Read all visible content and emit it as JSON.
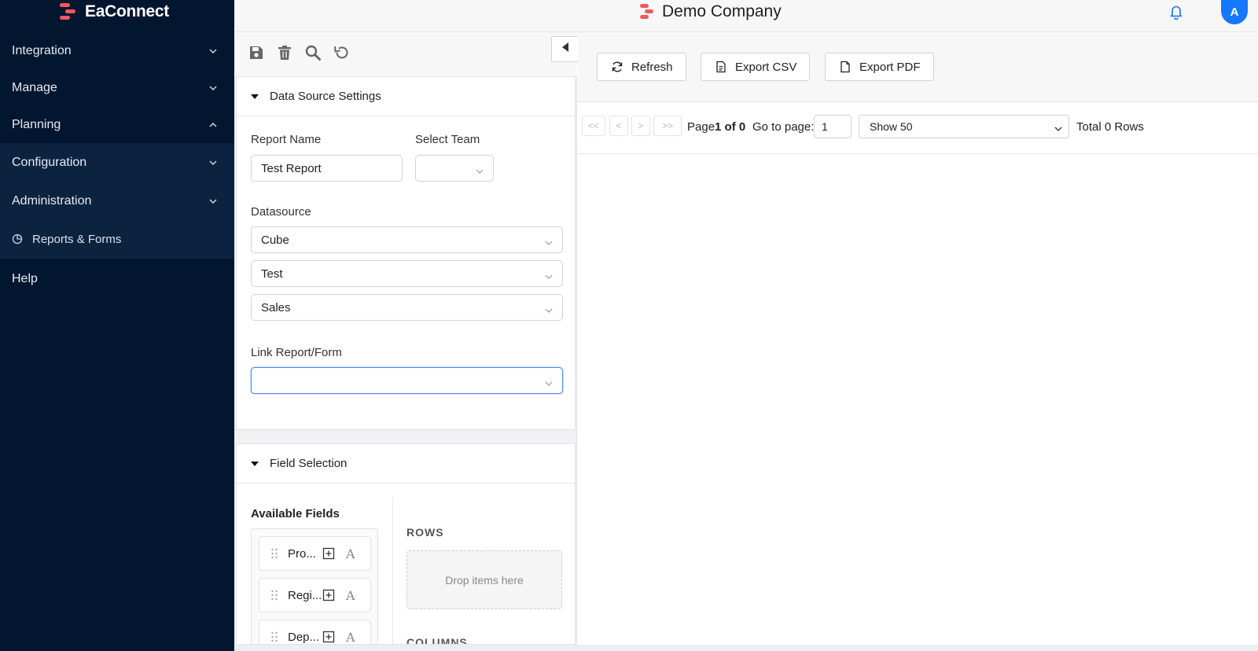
{
  "app": {
    "name": "EaConnect"
  },
  "header": {
    "company": "Demo Company",
    "avatar_initial": "A"
  },
  "sidebar": {
    "items": [
      {
        "label": "Integration",
        "chevron": "down"
      },
      {
        "label": "Manage",
        "chevron": "down"
      },
      {
        "label": "Planning",
        "chevron": "up"
      },
      {
        "label": "Configuration",
        "chevron": "down"
      },
      {
        "label": "Administration",
        "chevron": "down"
      },
      {
        "label": "Reports & Forms",
        "icon": "pie-chart-icon"
      },
      {
        "label": "Help"
      }
    ]
  },
  "toolbar": {
    "icons": [
      "save-icon",
      "delete-icon",
      "search-icon",
      "undo-icon",
      "collapse-left-icon"
    ]
  },
  "data_source": {
    "section_title": "Data Source Settings",
    "report_name_label": "Report Name",
    "report_name_value": "Test Report",
    "team_label": "Select Team",
    "team_value": "",
    "datasource_label": "Datasource",
    "datasource_values": [
      "Cube",
      "Test",
      "Sales"
    ],
    "link_label": "Link Report/Form",
    "link_value": ""
  },
  "field_selection": {
    "section_title": "Field Selection",
    "available_title": "Available Fields",
    "fields": [
      "Pro...",
      "Regi...",
      "Dep..."
    ],
    "rows_title": "ROWS",
    "drop_placeholder": "Drop items here",
    "columns_title": "COLUMNS"
  },
  "report": {
    "buttons": {
      "refresh": "Refresh",
      "export_csv": "Export CSV",
      "export_pdf": "Export PDF"
    },
    "pager": {
      "first": "<<",
      "prev": "<",
      "next": ">",
      "last": ">>",
      "page_prefix": "Page",
      "page_status": "1 of 0",
      "goto_label": "Go to page:",
      "goto_value": "1",
      "show_value": "Show 50",
      "total": "Total 0 Rows"
    }
  },
  "colors": {
    "sidebar": "#031630",
    "sidebar_sub": "#0c2340",
    "accent": "#1677ff",
    "brand": "#ef5a5a"
  }
}
